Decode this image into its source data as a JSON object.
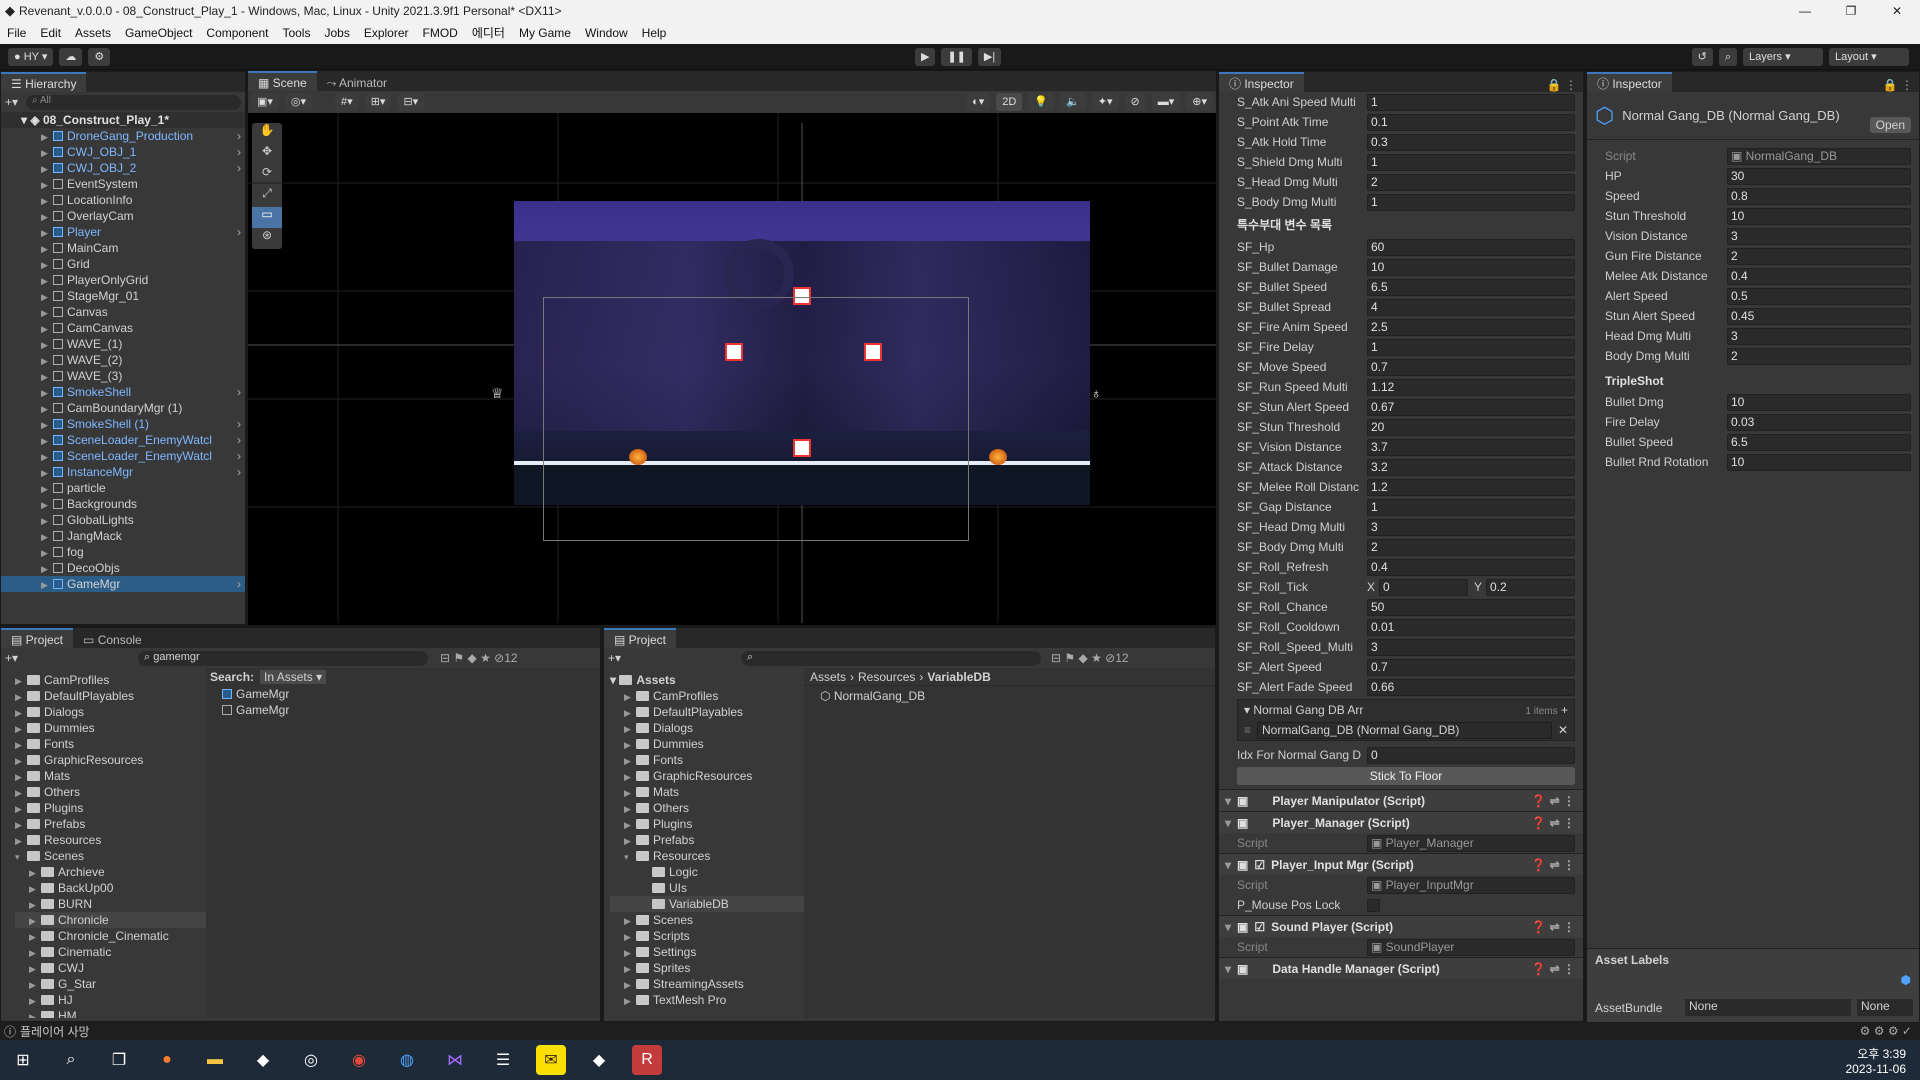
{
  "window": {
    "title": "Revenant_v.0.0.0 - 08_Construct_Play_1 - Windows, Mac, Linux - Unity 2021.3.9f1 Personal* <DX11>"
  },
  "menu": [
    "File",
    "Edit",
    "Assets",
    "GameObject",
    "Component",
    "Tools",
    "Jobs",
    "Explorer",
    "FMOD",
    "에디터",
    "My Game",
    "Window",
    "Help"
  ],
  "toolbar": {
    "account": "HY",
    "layers": "Layers",
    "layout": "Layout"
  },
  "hierarchy": {
    "tab": "Hierarchy",
    "search_placeholder": "All",
    "scene": "08_Construct_Play_1*",
    "items": [
      {
        "label": "DroneGang_Production",
        "prefab": true,
        "arrow": true
      },
      {
        "label": "CWJ_OBJ_1",
        "prefab": true,
        "arrow": true
      },
      {
        "label": "CWJ_OBJ_2",
        "prefab": true,
        "arrow": true
      },
      {
        "label": "EventSystem",
        "prefab": false
      },
      {
        "label": "LocationInfo",
        "prefab": false
      },
      {
        "label": "OverlayCam",
        "prefab": false
      },
      {
        "label": "Player",
        "prefab": true,
        "arrow": true
      },
      {
        "label": "MainCam",
        "prefab": false
      },
      {
        "label": "Grid",
        "prefab": false
      },
      {
        "label": "PlayerOnlyGrid",
        "prefab": false
      },
      {
        "label": "StageMgr_01",
        "prefab": false
      },
      {
        "label": "Canvas",
        "prefab": false
      },
      {
        "label": "CamCanvas",
        "prefab": false
      },
      {
        "label": "WAVE_(1)",
        "prefab": false
      },
      {
        "label": "WAVE_(2)",
        "prefab": false
      },
      {
        "label": "WAVE_(3)",
        "prefab": false
      },
      {
        "label": "SmokeShell",
        "prefab": true,
        "arrow": true
      },
      {
        "label": "CamBoundaryMgr (1)",
        "prefab": false
      },
      {
        "label": "SmokeShell (1)",
        "prefab": true,
        "arrow": true
      },
      {
        "label": "SceneLoader_EnemyWatcl",
        "prefab": true,
        "arrow": true
      },
      {
        "label": "SceneLoader_EnemyWatcl",
        "prefab": true,
        "arrow": true
      },
      {
        "label": "InstanceMgr",
        "prefab": true,
        "arrow": true
      },
      {
        "label": "particle",
        "prefab": false
      },
      {
        "label": "Backgrounds",
        "prefab": false
      },
      {
        "label": "GlobalLights",
        "prefab": false
      },
      {
        "label": "JangMack",
        "prefab": false
      },
      {
        "label": "fog",
        "prefab": false
      },
      {
        "label": "DecoObjs",
        "prefab": false
      },
      {
        "label": "GameMgr",
        "prefab": true,
        "selected": true,
        "arrow": true
      }
    ]
  },
  "scene_tabs": {
    "scene": "Scene",
    "animator": "Animator",
    "mode2d": "2D"
  },
  "project1": {
    "tab": "Project",
    "tab2": "Console",
    "search": "gamemgr",
    "search_in": "Search:",
    "in_assets": "In Assets",
    "count": "12",
    "tree": [
      "CamProfiles",
      "DefaultPlayables",
      "Dialogs",
      "Dummies",
      "Fonts",
      "GraphicResources",
      "Mats",
      "Others",
      "Plugins",
      "Prefabs",
      "Resources",
      "Scenes",
      "Archieve",
      "BackUp00",
      "BURN",
      "Chronicle",
      "Chronicle_Cinematic",
      "Cinematic",
      "CWJ",
      "G_Star",
      "HJ",
      "HM"
    ],
    "results": [
      "GameMgr",
      "GameMgr"
    ]
  },
  "project2": {
    "tab": "Project",
    "count": "12",
    "root": "Assets",
    "tree": [
      "CamProfiles",
      "DefaultPlayables",
      "Dialogs",
      "Dummies",
      "Fonts",
      "GraphicResources",
      "Mats",
      "Others",
      "Plugins",
      "Prefabs",
      "Resources",
      "Logic",
      "UIs",
      "VariableDB",
      "Scenes",
      "Scripts",
      "Settings",
      "Sprites",
      "StreamingAssets",
      "TextMesh Pro"
    ],
    "breadcrumb": [
      "Assets",
      "Resources",
      "VariableDB"
    ],
    "file": "NormalGang_DB"
  },
  "inspector1": {
    "tab": "Inspector",
    "fields_top": [
      {
        "l": "S_Atk Ani Speed Multi",
        "v": "1"
      },
      {
        "l": "S_Point Atk Time",
        "v": "0.1"
      },
      {
        "l": "S_Atk Hold Time",
        "v": "0.3"
      },
      {
        "l": "S_Shield Dmg Multi",
        "v": "1"
      },
      {
        "l": "S_Head Dmg Multi",
        "v": "2"
      },
      {
        "l": "S_Body Dmg Multi",
        "v": "1"
      }
    ],
    "sf_header": "특수부대 변수 목록",
    "fields_sf": [
      {
        "l": "SF_Hp",
        "v": "60"
      },
      {
        "l": "SF_Bullet Damage",
        "v": "10"
      },
      {
        "l": "SF_Bullet Speed",
        "v": "6.5"
      },
      {
        "l": "SF_Bullet Spread",
        "v": "4"
      },
      {
        "l": "SF_Fire Anim Speed",
        "v": "2.5"
      },
      {
        "l": "SF_Fire Delay",
        "v": "1"
      },
      {
        "l": "SF_Move Speed",
        "v": "0.7"
      },
      {
        "l": "SF_Run Speed Multi",
        "v": "1.12"
      },
      {
        "l": "SF_Stun Alert Speed",
        "v": "0.67"
      },
      {
        "l": "SF_Stun Threshold",
        "v": "20"
      },
      {
        "l": "SF_Vision Distance",
        "v": "3.7"
      },
      {
        "l": "SF_Attack Distance",
        "v": "3.2"
      },
      {
        "l": "SF_Melee Roll Distanc",
        "v": "1.2"
      },
      {
        "l": "SF_Gap Distance",
        "v": "1"
      },
      {
        "l": "SF_Head Dmg Multi",
        "v": "3"
      },
      {
        "l": "SF_Body Dmg Multi",
        "v": "2"
      },
      {
        "l": "SF_Roll_Refresh",
        "v": "0.4"
      }
    ],
    "roll_tick": {
      "l": "SF_Roll_Tick",
      "x": "0",
      "y": "0.2",
      "xl": "X",
      "yl": "Y"
    },
    "fields_sf2": [
      {
        "l": "SF_Roll_Chance",
        "v": "50"
      },
      {
        "l": "SF_Roll_Cooldown",
        "v": "0.01"
      },
      {
        "l": "SF_Roll_Speed_Multi",
        "v": "3"
      },
      {
        "l": "SF_Alert Speed",
        "v": "0.7"
      },
      {
        "l": "SF_Alert Fade Speed",
        "v": "0.66"
      }
    ],
    "arr_label": "Normal Gang DB Arr",
    "arr_count": "1 items",
    "arr_item": "NormalGang_DB (Normal Gang_DB)",
    "idx_label": "Idx For Normal Gang D",
    "idx_val": "0",
    "stick_button": "Stick To Floor",
    "components": [
      {
        "name": "Player Manipulator (Script)",
        "check": false
      },
      {
        "name": "Player_Manager (Script)",
        "check": false,
        "script": "Player_Manager"
      },
      {
        "name": "Player_Input Mgr (Script)",
        "check": true,
        "script": "Player_InputMgr",
        "extra": "P_Mouse Pos Lock"
      },
      {
        "name": "Sound Player (Script)",
        "check": true,
        "script": "SoundPlayer"
      },
      {
        "name": "Data Handle Manager (Script)",
        "check": false
      }
    ],
    "script_label": "Script"
  },
  "inspector2": {
    "tab": "Inspector",
    "title": "Normal Gang_DB (Normal Gang_DB)",
    "open": "Open",
    "script_label": "Script",
    "script": "NormalGang_DB",
    "fields": [
      {
        "l": "HP",
        "v": "30"
      },
      {
        "l": "Speed",
        "v": "0.8"
      },
      {
        "l": "Stun Threshold",
        "v": "10"
      },
      {
        "l": "Vision Distance",
        "v": "3"
      },
      {
        "l": "Gun Fire Distance",
        "v": "2"
      },
      {
        "l": "Melee Atk Distance",
        "v": "0.4"
      },
      {
        "l": "Alert Speed",
        "v": "0.5"
      },
      {
        "l": "Stun Alert Speed",
        "v": "0.45"
      },
      {
        "l": "Head Dmg Multi",
        "v": "3"
      },
      {
        "l": "Body Dmg Multi",
        "v": "2"
      }
    ],
    "triple_header": "TripleShot",
    "triple": [
      {
        "l": "Bullet Dmg",
        "v": "10"
      },
      {
        "l": "Fire Delay",
        "v": "0.03"
      },
      {
        "l": "Bullet Speed",
        "v": "6.5"
      },
      {
        "l": "Bullet Rnd Rotation",
        "v": "10"
      }
    ],
    "asset_labels": "Asset Labels",
    "asset_bundle": "AssetBundle",
    "none1": "None",
    "none2": "None"
  },
  "status": {
    "text": "플레이어 사망"
  },
  "taskbar": {
    "time": "오후 3:39",
    "date": "2023-11-06"
  }
}
